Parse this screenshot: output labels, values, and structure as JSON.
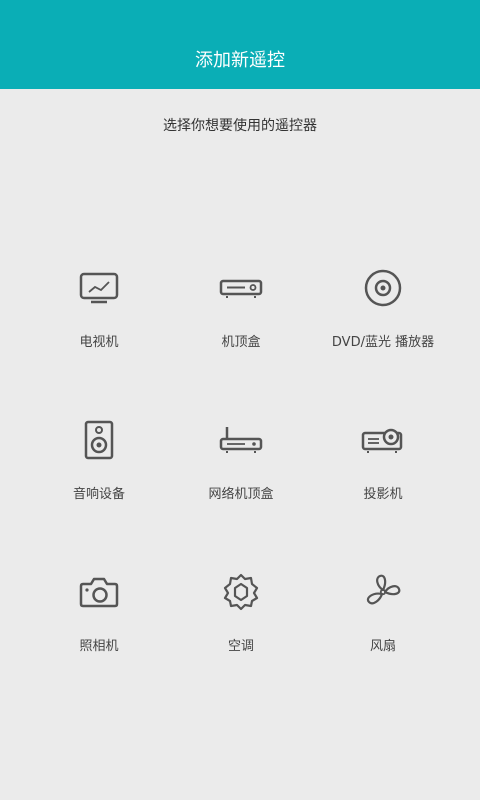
{
  "header": {
    "title": "添加新遥控"
  },
  "subtitle": "选择你想要使用的遥控器",
  "colors": {
    "header_bg": "#0aaeb6",
    "background": "#ebebeb",
    "icon_stroke": "#555555"
  },
  "devices": [
    {
      "label": "电视机",
      "icon": "tv-icon"
    },
    {
      "label": "机顶盒",
      "icon": "set-top-box-icon"
    },
    {
      "label": "DVD/蓝光 播放器",
      "icon": "disc-icon"
    },
    {
      "label": "音响设备",
      "icon": "speaker-icon"
    },
    {
      "label": "网络机顶盒",
      "icon": "network-box-icon"
    },
    {
      "label": "投影机",
      "icon": "projector-icon"
    },
    {
      "label": "照相机",
      "icon": "camera-icon"
    },
    {
      "label": "空调",
      "icon": "air-conditioner-icon"
    },
    {
      "label": "风扇",
      "icon": "fan-icon"
    }
  ]
}
